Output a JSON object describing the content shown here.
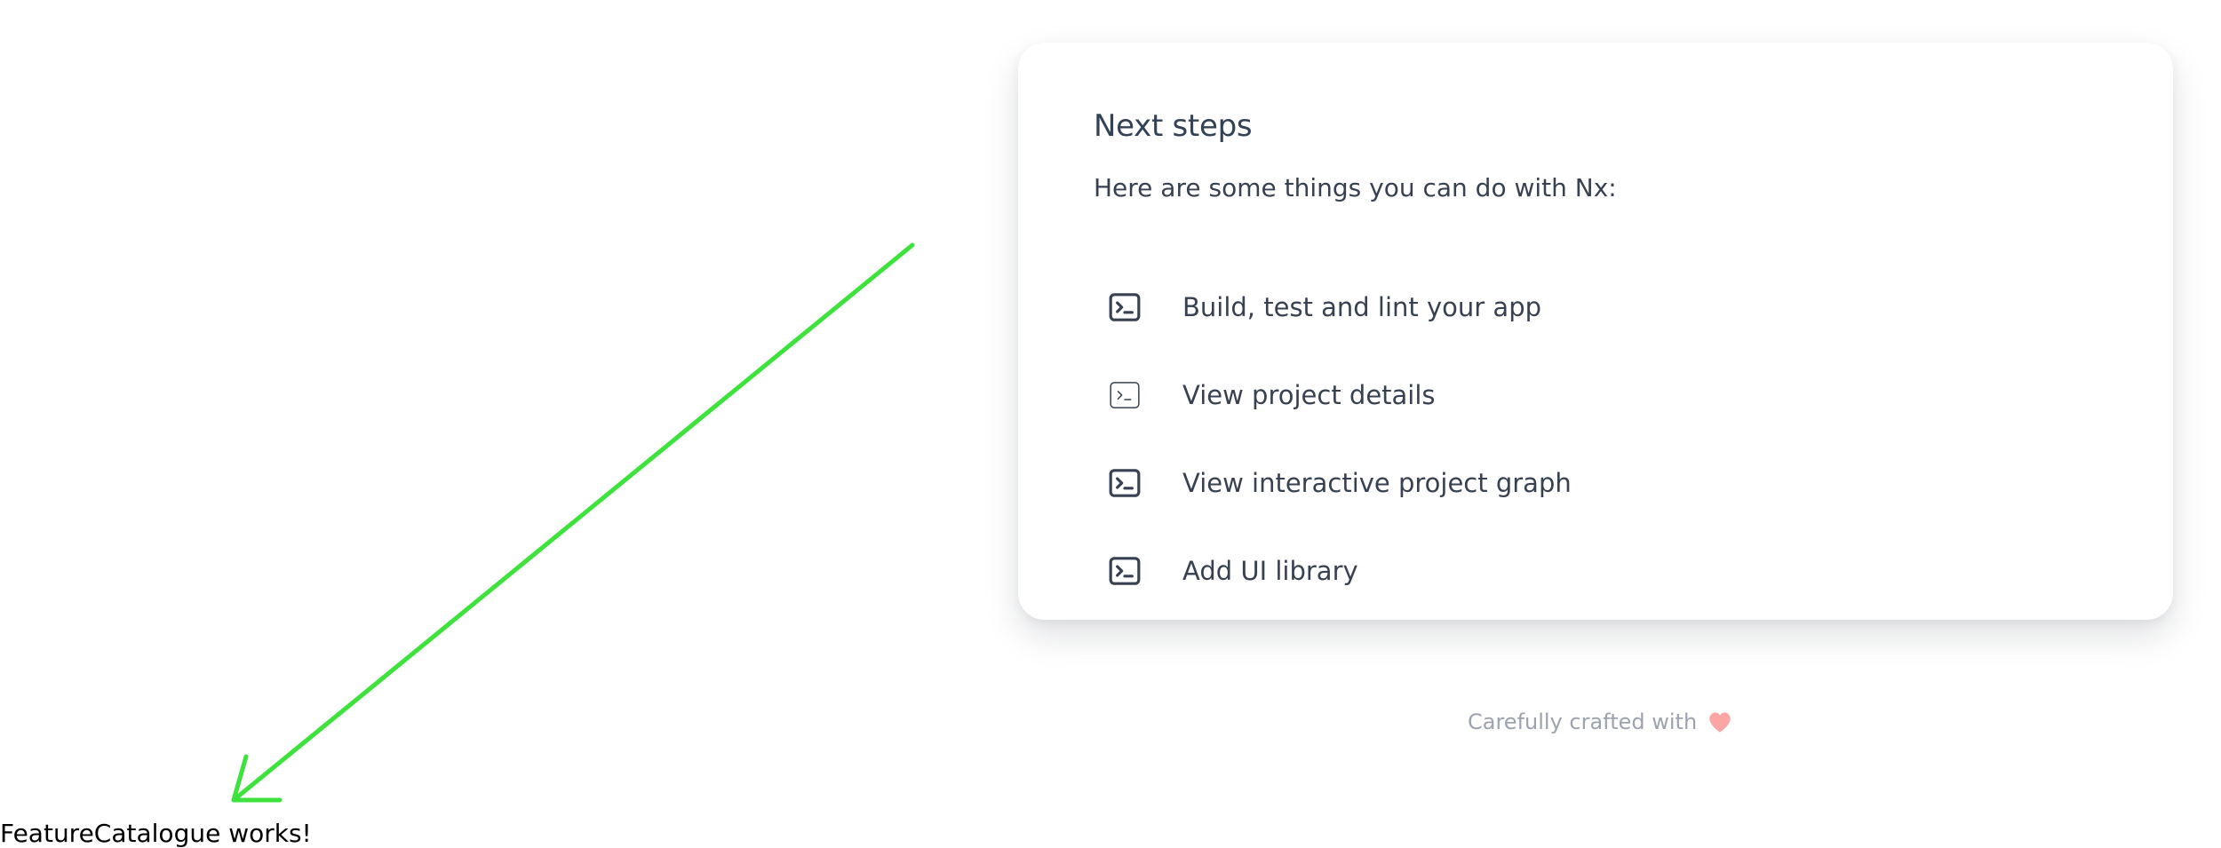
{
  "next_steps": {
    "title": "Next steps",
    "intro": "Here are some things you can do with Nx:",
    "items": [
      {
        "label": "Build, test and lint your app",
        "icon": "terminal-icon"
      },
      {
        "label": "View project details",
        "icon": "terminal-icon"
      },
      {
        "label": "View interactive project graph",
        "icon": "terminal-icon"
      },
      {
        "label": "Add UI library",
        "icon": "terminal-icon"
      }
    ]
  },
  "footer": {
    "text": "Carefully crafted with",
    "icon": "heart-icon"
  },
  "app": {
    "message": "FeatureCatalogue works!"
  },
  "colors": {
    "arrow": "#3de23d",
    "heart": "#fca5a5",
    "text": "#374151",
    "muted": "#9ca3af"
  }
}
